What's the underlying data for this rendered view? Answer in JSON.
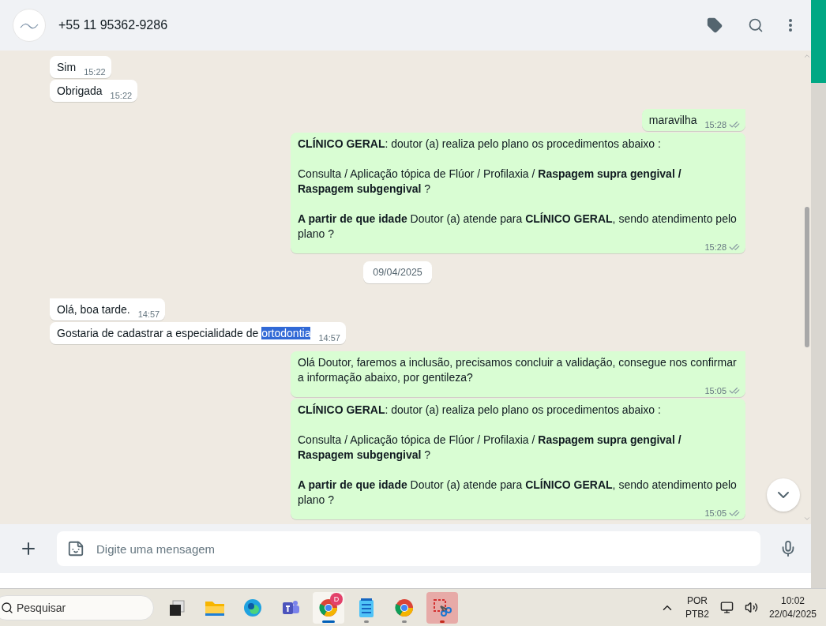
{
  "header": {
    "contact": "+55 11 95362-9286"
  },
  "messages": [
    {
      "kind": "incoming",
      "text": "Sim",
      "time": "15:22"
    },
    {
      "kind": "incoming",
      "text": "Obrigada",
      "time": "15:22",
      "tail": false
    },
    {
      "kind": "outgoing",
      "text": "maravilha",
      "time": "15:28",
      "read": false,
      "tail": true
    },
    {
      "kind": "outgoing",
      "text": "**CLÍNICO GERAL**: doutor (a) realiza pelo plano os procedimentos abaixo :\n\nConsulta / Aplicação tópica de Flúor / Profilaxia / **Raspagem supra gengival / Raspagem subgengival** ?\n\n**A partir de que idade** Doutor (a) atende para **CLÍNICO GERAL**, sendo atendimento pelo plano ?",
      "time": "15:28",
      "read": false,
      "tail": false
    },
    {
      "kind": "date",
      "text": "09/04/2025"
    },
    {
      "kind": "incoming",
      "text": "Olá, boa tarde.",
      "time": "14:57",
      "tail": true
    },
    {
      "kind": "incoming",
      "text": "Gostaria de cadastrar a especialidade de ",
      "selected_text": "ortodontia",
      "time": "14:57",
      "tail": false
    },
    {
      "kind": "outgoing",
      "text": "Olá Doutor, faremos a inclusão, precisamos concluir a validação, consegue nos confirmar a informação abaixo, por gentileza?",
      "time": "15:05",
      "read": false,
      "tail": true
    },
    {
      "kind": "outgoing",
      "text": "**CLÍNICO GERAL**: doutor (a) realiza pelo plano os procedimentos abaixo :\n\nConsulta / Aplicação tópica de Flúor / Profilaxia / **Raspagem supra gengival / Raspagem subgengival** ?\n\n**A partir de que idade** Doutor (a) atende para **CLÍNICO GERAL**, sendo atendimento pelo plano ?",
      "time": "15:05",
      "read": false,
      "tail": false
    }
  ],
  "composer": {
    "placeholder": "Digite uma mensagem"
  },
  "taskbar": {
    "search_placeholder": "Pesquisar",
    "apps": [
      {
        "kind": "taskview",
        "running": false,
        "active": false,
        "attention": false
      },
      {
        "kind": "folder",
        "running": false,
        "active": false,
        "attention": false
      },
      {
        "kind": "edge",
        "running": false,
        "active": false,
        "attention": false
      },
      {
        "kind": "teams",
        "running": false,
        "active": false,
        "attention": false
      },
      {
        "kind": "chrome",
        "running": true,
        "active": true,
        "attention": false,
        "badge": "D"
      },
      {
        "kind": "notepad",
        "running": true,
        "active": false,
        "attention": false
      },
      {
        "kind": "chrome",
        "running": true,
        "active": false,
        "attention": false
      },
      {
        "kind": "snip",
        "running": true,
        "active": false,
        "attention": true
      }
    ],
    "language": "POR",
    "layout": "PTB2",
    "time": "10:02",
    "date": "22/04/2025"
  }
}
